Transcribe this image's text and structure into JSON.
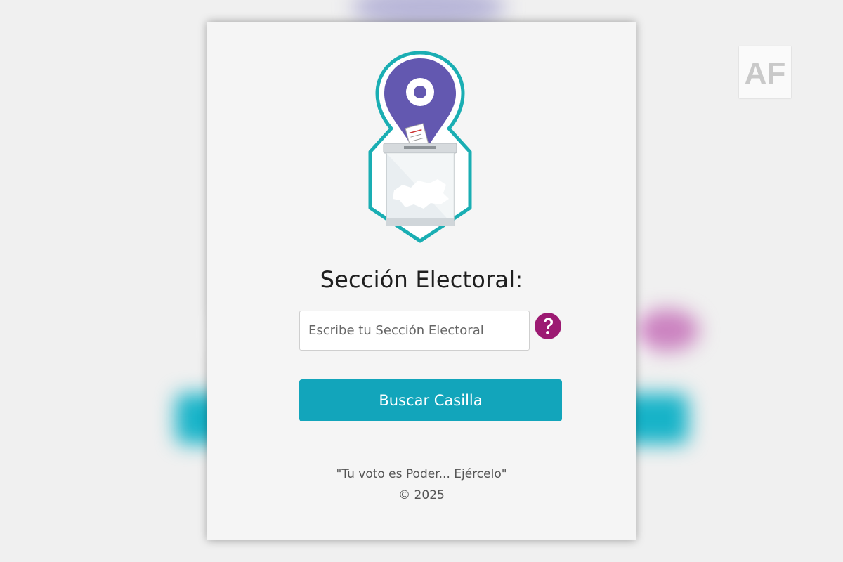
{
  "watermark": {
    "text": "AF"
  },
  "form": {
    "title": "Sección Electoral:",
    "input_placeholder": "Escribe tu Sección Electoral",
    "input_value": "",
    "help_icon": "question-circle-icon",
    "search_label": "Buscar Casilla"
  },
  "footer": {
    "slogan": "\"Tu voto es Poder... Ejércelo\"",
    "copyright": "© 2025"
  },
  "colors": {
    "accent": "#12a5bb",
    "help": "#9c1a72",
    "pin": "#6358b0",
    "frame": "#1aaeb3"
  }
}
